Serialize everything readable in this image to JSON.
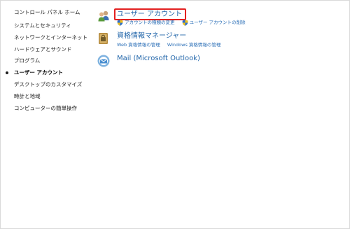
{
  "sidebar": {
    "home": "コントロール パネル ホーム",
    "items": [
      {
        "label": "システムとセキュリティ"
      },
      {
        "label": "ネットワークとインターネット"
      },
      {
        "label": "ハードウェアとサウンド"
      },
      {
        "label": "プログラム"
      },
      {
        "label": "ユーザー アカウント",
        "current": true
      },
      {
        "label": "デスクトップのカスタマイズ"
      },
      {
        "label": "時計と地域"
      },
      {
        "label": "コンピューターの簡単操作"
      }
    ]
  },
  "categories": [
    {
      "title": "ユーザー アカウント",
      "icon": "users-icon",
      "highlighted": true,
      "links": [
        "アカウントの種類の変更",
        "ユーザー アカウントの削除"
      ]
    },
    {
      "title": "資格情報マネージャー",
      "icon": "credential-manager-icon",
      "highlighted": false,
      "links": [
        "Web 資格情報の管理",
        "Windows 資格情報の管理"
      ]
    },
    {
      "title": "Mail (Microsoft Outlook)",
      "icon": "mail-icon",
      "highlighted": false,
      "links": []
    }
  ],
  "colors": {
    "link": "#2266aa",
    "highlight_border": "#e32020"
  }
}
